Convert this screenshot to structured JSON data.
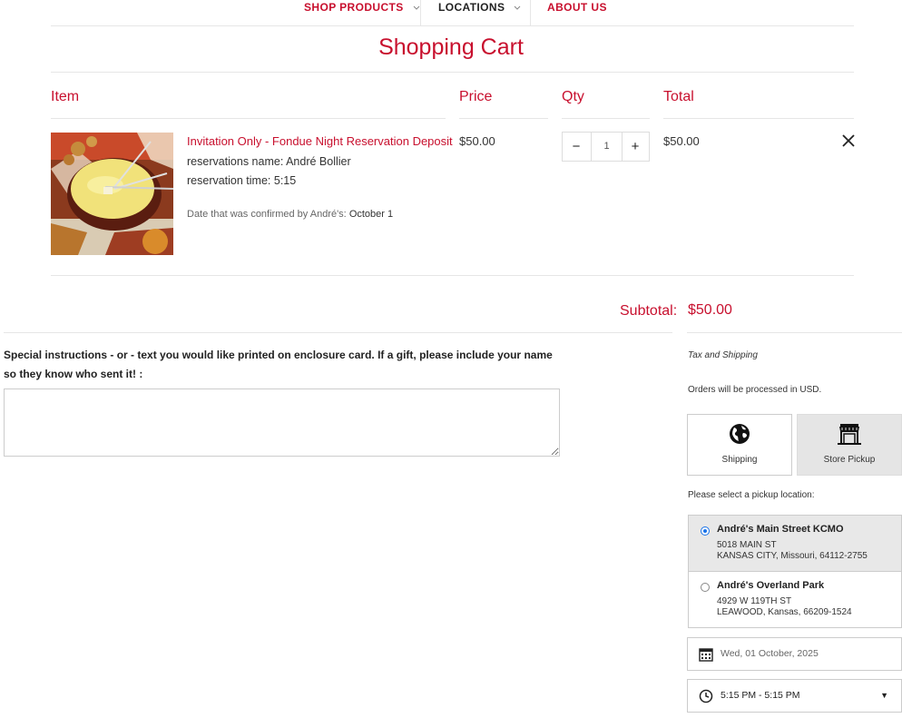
{
  "nav": {
    "items": [
      {
        "label": "SHOP PRODUCTS",
        "has_dropdown": true,
        "color": "#c8102e"
      },
      {
        "label": "LOCATIONS",
        "has_dropdown": true,
        "color": "#222222"
      },
      {
        "label": "ABOUT US",
        "has_dropdown": false,
        "color": "#c8102e"
      }
    ]
  },
  "page": {
    "title": "Shopping Cart"
  },
  "cart": {
    "headers": {
      "item": "Item",
      "price": "Price",
      "qty": "Qty",
      "total": "Total"
    },
    "items": [
      {
        "title": "Invitation Only - Fondue Night Reservation Deposit",
        "line1": "reservations name: André Bollier",
        "line2": "reservation time: 5:15",
        "note_label": "Date that was confirmed by André's:",
        "note_value": "October 1",
        "price": "$50.00",
        "qty": "1",
        "total": "$50.00"
      }
    ],
    "subtotal_label": "Subtotal:",
    "subtotal_value": "$50.00"
  },
  "instructions": {
    "label": "Special instructions - or - text you would like printed on enclosure card. If a gift, please include your name so they know who sent it! :",
    "value": ""
  },
  "checkout": {
    "tax_shipping": "Tax and Shipping",
    "currency_note": "Orders will be processed in USD.",
    "methods": [
      {
        "label": "Shipping",
        "icon": "globe-icon",
        "selected": false
      },
      {
        "label": "Store Pickup",
        "icon": "store-icon",
        "selected": true
      }
    ],
    "pickup_prompt": "Please select a pickup location:",
    "locations": [
      {
        "name": "André's Main Street KCMO",
        "address1": "5018 MAIN ST",
        "address2": "KANSAS CITY, Missouri, 64112-2755",
        "selected": true
      },
      {
        "name": "André's Overland Park",
        "address1": "4929 W 119TH ST",
        "address2": "LEAWOOD, Kansas, 66209-1524",
        "selected": false
      }
    ],
    "date": "Wed, 01 October, 2025",
    "time": "5:15 PM - 5:15 PM"
  },
  "colors": {
    "accent": "#c8102e",
    "selected_bg": "#e5e5e5",
    "radio": "#1a73e8"
  }
}
